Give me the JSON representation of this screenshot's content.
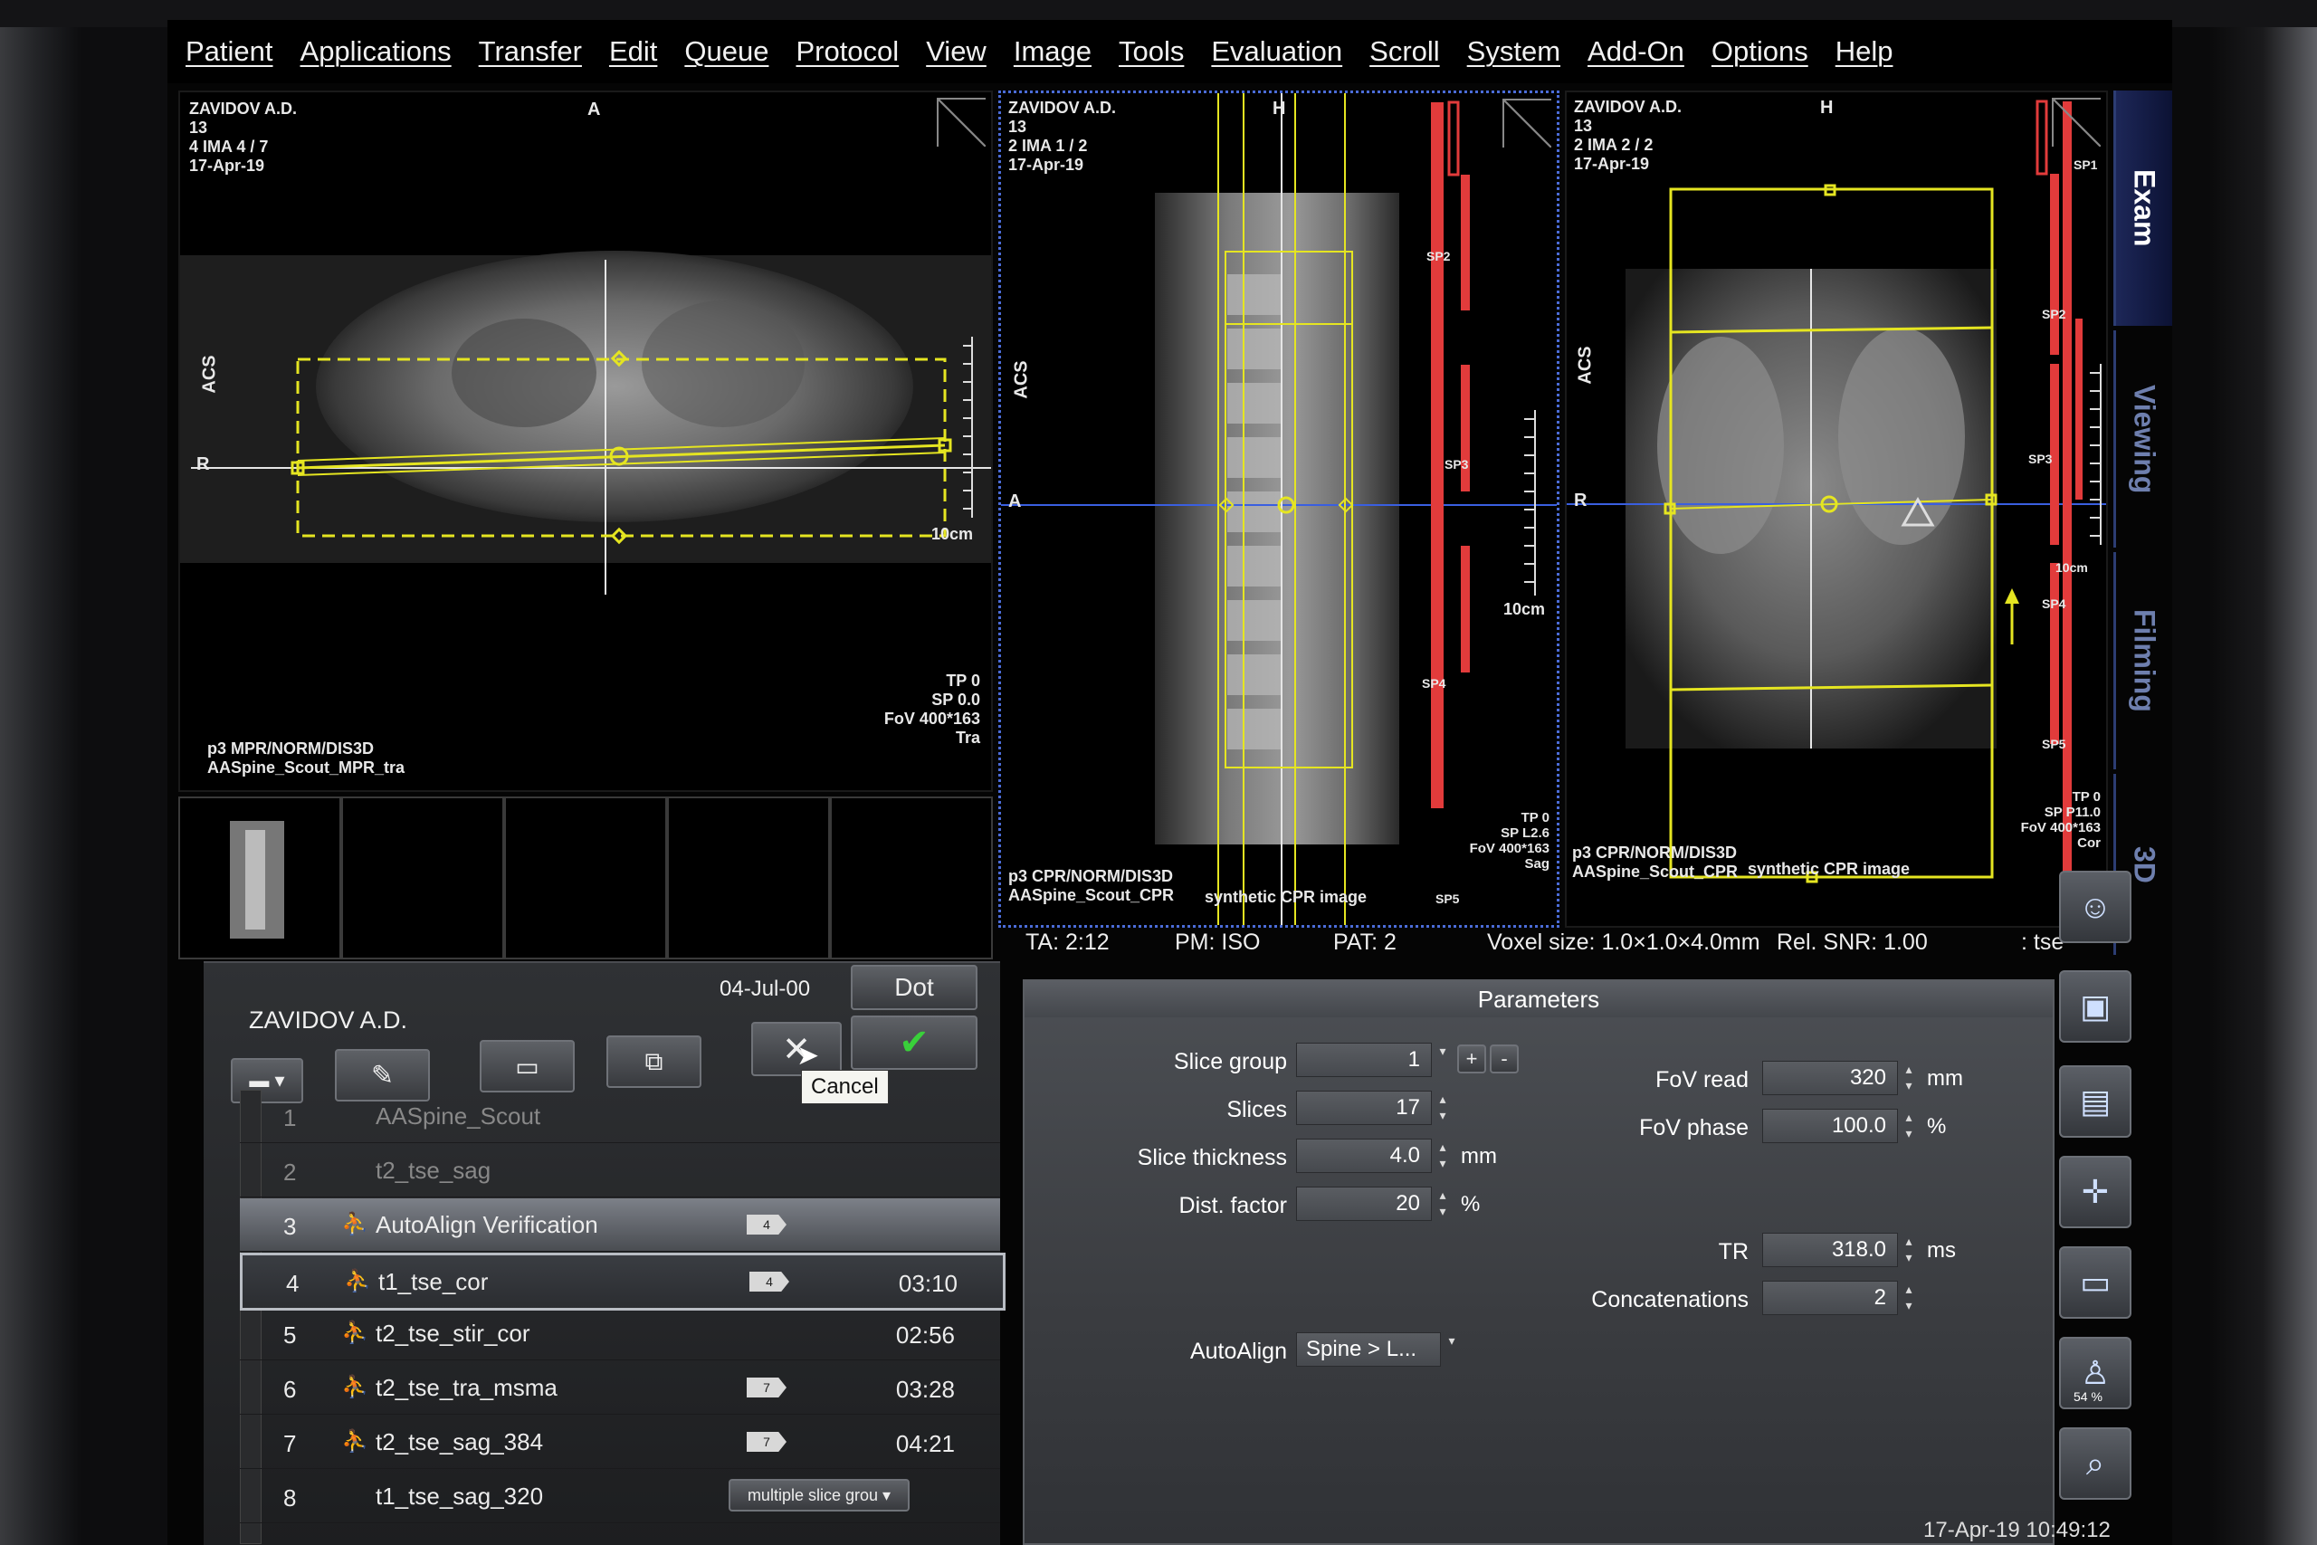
{
  "menu": [
    "Patient",
    "Applications",
    "Transfer",
    "Edit",
    "Queue",
    "Protocol",
    "View",
    "Image",
    "Tools",
    "Evaluation",
    "Scroll",
    "System",
    "Add-On",
    "Options",
    "Help"
  ],
  "vp1": {
    "header": "ZAVIDOV A.D.\n13\n4 IMA 4 / 7\n17-Apr-19",
    "top_orient": "A",
    "left_orient": "ACS",
    "r_orient": "R",
    "scale": "10cm",
    "br": "TP 0\nSP 0.0\nFoV 400*163\nTra",
    "bl": "p3 MPR/NORM/DIS3D\nAASpine_Scout_MPR_tra"
  },
  "vp2": {
    "header": "ZAVIDOV A.D.\n13\n2 IMA 1 / 2\n17-Apr-19",
    "top_orient": "H",
    "left_orient": "ACS",
    "a_orient": "A",
    "scale": "10cm",
    "sp2": "SP2",
    "sp3": "SP3",
    "sp4": "SP4",
    "sp5": "SP5",
    "br": "TP 0\nSP L2.6\nFoV 400*163\nSag",
    "bl": "p3 CPR/NORM/DIS3D\nAASpine_Scout_CPR",
    "bc": "synthetic CPR image"
  },
  "vp3": {
    "header": "ZAVIDOV A.D.\n13\n2 IMA 2 / 2\n17-Apr-19",
    "top_orient": "H",
    "left_orient": "ACS",
    "r_orient": "R",
    "sp1": "SP1",
    "sp2": "SP2",
    "sp3": "SP3",
    "sp4": "SP4",
    "sp5": "SP5",
    "scale": "10cm",
    "br": "TP 0\nSP P11.0\nFoV 400*163\nCor",
    "bl": "p3 CPR/NORM/DIS3D\nAASpine_Scout_CPR",
    "bc": "synthetic CPR image"
  },
  "sidetabs": [
    "Exam",
    "Viewing",
    "Filming",
    "3D"
  ],
  "info": {
    "ta": "TA: 2:12",
    "pm": "PM: ISO",
    "pat": "PAT: 2",
    "voxel": "Voxel size: 1.0×1.0×4.0mm",
    "snr": "Rel. SNR: 1.00",
    "seq": ": tse"
  },
  "patient": {
    "name": "ZAVIDOV A.D.",
    "date": "04-Jul-00",
    "dot_label": "Dot",
    "cancel_tooltip": "Cancel"
  },
  "protocols": [
    {
      "num": "1",
      "name": "AASpine_Scout",
      "time": "",
      "flag": ""
    },
    {
      "num": "2",
      "name": "t2_tse_sag",
      "time": "",
      "flag": ""
    },
    {
      "num": "3",
      "name": "AutoAlign Verification",
      "time": "",
      "flag": "4"
    },
    {
      "num": "4",
      "name": "t1_tse_cor",
      "time": "03:10",
      "flag": "4"
    },
    {
      "num": "5",
      "name": "t2_tse_stir_cor",
      "time": "02:56",
      "flag": ""
    },
    {
      "num": "6",
      "name": "t2_tse_tra_msma",
      "time": "03:28",
      "flag": "7"
    },
    {
      "num": "7",
      "name": "t2_tse_sag_384",
      "time": "04:21",
      "flag": "7"
    },
    {
      "num": "8",
      "name": "t1_tse_sag_320",
      "time": "",
      "flag": ""
    }
  ],
  "slice_group_select": "multiple slice grou",
  "parameters": {
    "title": "Parameters",
    "slice_group": {
      "label": "Slice group",
      "value": "1"
    },
    "slices": {
      "label": "Slices",
      "value": "17"
    },
    "slice_thickness": {
      "label": "Slice thickness",
      "value": "4.0",
      "unit": "mm"
    },
    "dist_factor": {
      "label": "Dist. factor",
      "value": "20",
      "unit": "%"
    },
    "autoalign": {
      "label": "AutoAlign",
      "value": "Spine > L..."
    },
    "fov_read": {
      "label": "FoV read",
      "value": "320",
      "unit": "mm"
    },
    "fov_phase": {
      "label": "FoV phase",
      "value": "100.0",
      "unit": "%"
    },
    "tr": {
      "label": "TR",
      "value": "318.0",
      "unit": "ms"
    },
    "concatenations": {
      "label": "Concatenations",
      "value": "2"
    },
    "plus": "+",
    "minus": "-"
  },
  "tools": {
    "progress": "54 %"
  },
  "clock": "17-Apr-19 10:49:12",
  "colors": {
    "accent_blue": "#4b6cd8",
    "overlay_yellow": "#e5e521",
    "overlay_red": "#e23b3b"
  }
}
